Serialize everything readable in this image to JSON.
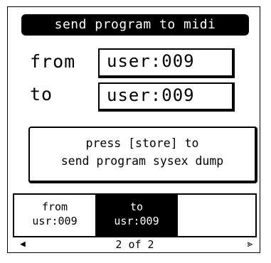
{
  "title": "send program to midi",
  "from": {
    "label": "from",
    "value": "user:009"
  },
  "to": {
    "label": "to",
    "value": "user:009"
  },
  "message": {
    "line1": "press [store] to",
    "line2": "send program sysex dump"
  },
  "tabs": [
    {
      "label": "from",
      "value": "usr:009",
      "selected": false
    },
    {
      "label": "to",
      "value": "usr:009",
      "selected": true
    },
    {
      "label": "",
      "value": "",
      "selected": false
    }
  ],
  "pager": {
    "text": "2 of 2",
    "prev_icon": "triangle-left-icon",
    "next_icon": "chevron-right-icon"
  },
  "colors": {
    "foreground": "#000000",
    "background": "#ffffff"
  }
}
